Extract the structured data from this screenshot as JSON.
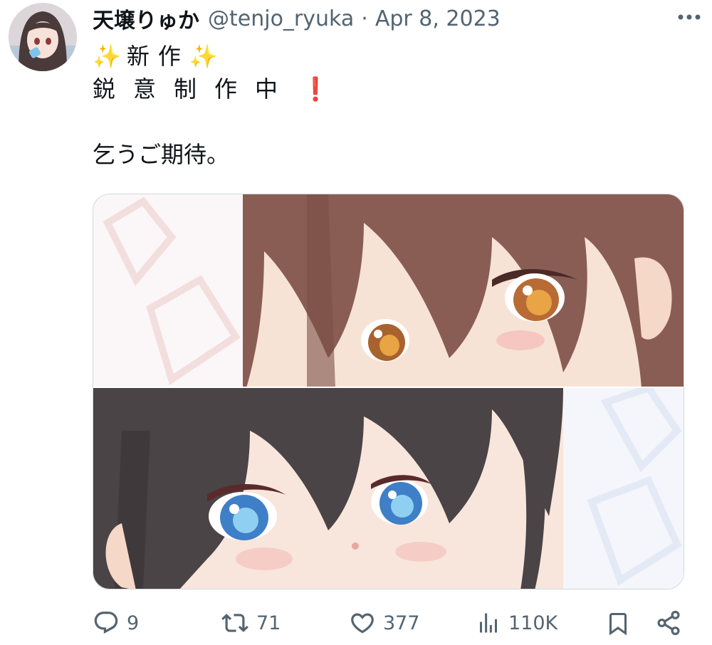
{
  "author": {
    "display_name": "天壌りゅか",
    "handle": "@tenjo_ryuka",
    "separator": "·",
    "date": "Apr 8, 2023"
  },
  "tweet": {
    "line1_sparkle_left": "✨",
    "line1_text": "新作",
    "line1_sparkle_right": "✨",
    "line2_chars": [
      "鋭",
      "意",
      "制",
      "作",
      "中"
    ],
    "line2_emoji": "❗",
    "line3_text": "乞うご期待。"
  },
  "media": {
    "image_1_icon": "anime-eyes-brown-hair",
    "image_2_icon": "anime-eyes-black-hair-blue-eyes"
  },
  "actions": {
    "replies": "9",
    "retweets": "71",
    "likes": "377",
    "views": "110K"
  },
  "colors": {
    "text": "#0f1419",
    "secondary": "#536471",
    "border": "#cfd9de",
    "emoji_red": "#d0202a",
    "sparkle": "#f7c531"
  }
}
